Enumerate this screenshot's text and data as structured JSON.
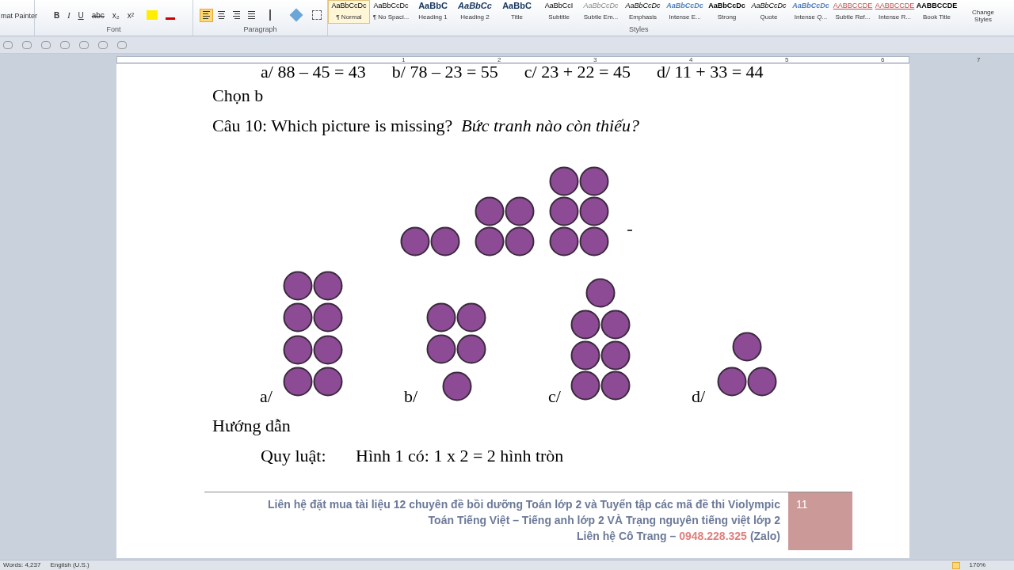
{
  "ribbon": {
    "clipboard": {
      "format_painter": "mat Painter"
    },
    "font": {
      "label": "Font",
      "buttons": [
        "B",
        "I",
        "U",
        "abc",
        "x₂",
        "x²"
      ]
    },
    "paragraph": {
      "label": "Paragraph",
      "alignments": [
        {
          "selected": true
        },
        {
          "selected": false
        },
        {
          "selected": false
        },
        {
          "selected": false
        }
      ]
    },
    "styles": {
      "label": "Styles",
      "items": [
        {
          "sample": "AaBbCcDc",
          "name": "¶ Normal",
          "selected": true,
          "kind": "normal"
        },
        {
          "sample": "AaBbCcDc",
          "name": "¶ No Spaci...",
          "selected": false,
          "kind": "normal"
        },
        {
          "sample": "AaBbC",
          "name": "Heading 1",
          "selected": false,
          "kind": "heading"
        },
        {
          "sample": "AaBbCc",
          "name": "Heading 2",
          "selected": false,
          "kind": "heading2"
        },
        {
          "sample": "AaBbC",
          "name": "Title",
          "selected": false,
          "kind": "heading"
        },
        {
          "sample": "AaBbCcI",
          "name": "Subtitle",
          "selected": false,
          "kind": "normal"
        },
        {
          "sample": "AaBbCcDc",
          "name": "Subtle Em...",
          "selected": false,
          "kind": "subtle"
        },
        {
          "sample": "AaBbCcDc",
          "name": "Emphasis",
          "selected": false,
          "kind": "italic"
        },
        {
          "sample": "AaBbCcDc",
          "name": "Intense E...",
          "selected": false,
          "kind": "intense"
        },
        {
          "sample": "AaBbCcDc",
          "name": "Strong",
          "selected": false,
          "kind": "strong"
        },
        {
          "sample": "AaBbCcDc",
          "name": "Quote",
          "selected": false,
          "kind": "italic"
        },
        {
          "sample": "AaBbCcDc",
          "name": "Intense Q...",
          "selected": false,
          "kind": "intense"
        },
        {
          "sample": "AABBCCDE",
          "name": "Subtle Ref...",
          "selected": false,
          "kind": "ref"
        },
        {
          "sample": "AABBCCDE",
          "name": "Intense R...",
          "selected": false,
          "kind": "ref"
        },
        {
          "sample": "AABBCCDE",
          "name": "Book Title",
          "selected": false,
          "kind": "strong"
        }
      ],
      "change_styles": "Change Styles"
    }
  },
  "ruler": [
    "1",
    "2",
    "3",
    "4",
    "5",
    "6",
    "7"
  ],
  "document": {
    "top_line": "a/ 88 – 45 = 43      b/ 78 – 23 = 55      c/ 23 + 22 = 45      d/ 11 + 33 = 44",
    "answer": "Chọn b",
    "question": "Câu 10: Which picture is missing?  *Bức tranh nào còn thiếu?*",
    "options": [
      "a/",
      "b/",
      "c/",
      "d/"
    ],
    "guide_title": "Hướng dẫn",
    "rule_label": "Quy luật:",
    "rule_text": "Hình 1 có: 1 x 2 = 2 hình tròn"
  },
  "footer": {
    "lines": [
      "Liên hệ đặt mua tài liệu 12 chuyên đề bồi dưỡng Toán lớp 2 và Tuyển tập các mã đề thi Violympic",
      "Toán Tiếng Việt – Tiếng anh lớp 2 VÀ Trạng nguyên tiếng việt lớp 2"
    ],
    "contact": "Liên hệ Cô Trang –",
    "phone": "0948.228.325",
    "zalo": "(Zalo)",
    "page_number": "11"
  },
  "status_bar": {
    "words": "Words: 4,237",
    "language": "English (U.S.)",
    "zoom": "170%"
  }
}
